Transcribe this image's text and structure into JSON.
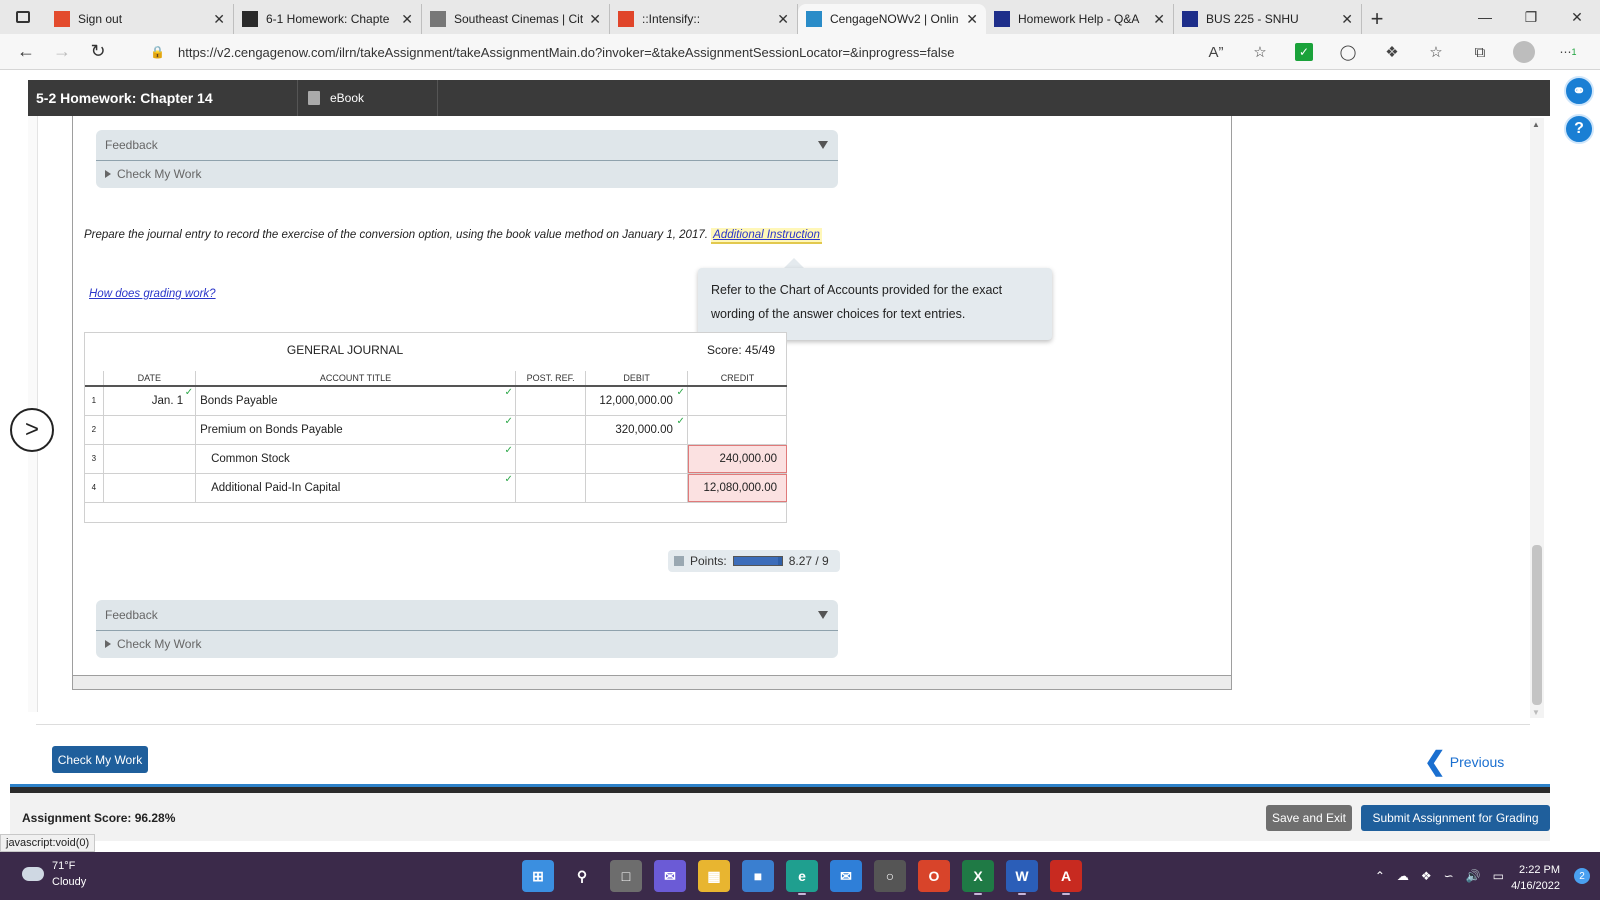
{
  "browser": {
    "tabs": [
      {
        "title": "Sign out",
        "icon": "windows-icon",
        "color": "#e34b2d"
      },
      {
        "title": "6-1 Homework: Chapte",
        "icon": "d2l-icon",
        "color": "#2b2b2b"
      },
      {
        "title": "Southeast Cinemas | Cit",
        "icon": "document-icon",
        "color": "#777777"
      },
      {
        "title": "::Intensify::",
        "icon": "intensify-icon",
        "color": "#e0452a"
      },
      {
        "title": "CengageNOWv2 | Onlin",
        "icon": "cengage-icon",
        "color": "#2a8cc8",
        "active": true
      },
      {
        "title": "Homework Help - Q&A",
        "icon": "star-shield-icon",
        "color": "#1e2e8a"
      },
      {
        "title": "BUS 225 - SNHU",
        "icon": "star-shield-icon",
        "color": "#1e2e8a"
      }
    ],
    "url": "https://v2.cengagenow.com/ilrn/takeAssignment/takeAssignmentMain.do?invoker=&takeAssignmentSessionLocator=&inprogress=false",
    "status_url": "javascript:void(0)",
    "ext_badge": "1"
  },
  "app": {
    "title": "5-2 Homework: Chapter 14",
    "ebook_label": "eBook"
  },
  "feedback": {
    "title": "Feedback",
    "check_label": "Check My Work"
  },
  "question": {
    "instruction": "Prepare the journal entry to record the exercise of the conversion option, using the book value method on January 1, 2017.",
    "additional_link": "Additional Instruction",
    "grading_link": "How does grading work?",
    "tooltip": "Refer to the Chart of Accounts provided for the exact wording of the answer choices for text entries."
  },
  "journal": {
    "title": "GENERAL JOURNAL",
    "score_text": "Score: 45/49",
    "headers": {
      "date": "DATE",
      "account": "ACCOUNT TITLE",
      "post": "POST. REF.",
      "debit": "DEBIT",
      "credit": "CREDIT"
    },
    "rows": [
      {
        "num": "1",
        "date": "Jan. 1",
        "account": "Bonds Payable",
        "post": "",
        "debit": "12,000,000.00",
        "credit": "",
        "indent": false,
        "credit_wrong": false
      },
      {
        "num": "2",
        "date": "",
        "account": "Premium on Bonds Payable",
        "post": "",
        "debit": "320,000.00",
        "credit": "",
        "indent": false,
        "credit_wrong": false
      },
      {
        "num": "3",
        "date": "",
        "account": "Common Stock",
        "post": "",
        "debit": "",
        "credit": "240,000.00",
        "indent": true,
        "credit_wrong": true
      },
      {
        "num": "4",
        "date": "",
        "account": "Additional Paid-In Capital",
        "post": "",
        "debit": "",
        "credit": "12,080,000.00",
        "indent": true,
        "credit_wrong": true
      }
    ]
  },
  "points": {
    "label": "Points:",
    "value_text": "8.27 / 9",
    "fraction": 0.9189
  },
  "footer": {
    "check_button": "Check My Work",
    "previous_label": "Previous",
    "assignment_score": "Assignment Score: 96.28%",
    "save_exit": "Save and Exit",
    "submit": "Submit Assignment for Grading"
  },
  "taskbar": {
    "temp": "71°F",
    "condition": "Cloudy",
    "time": "2:22 PM",
    "date": "4/16/2022",
    "notif_count": "2"
  }
}
